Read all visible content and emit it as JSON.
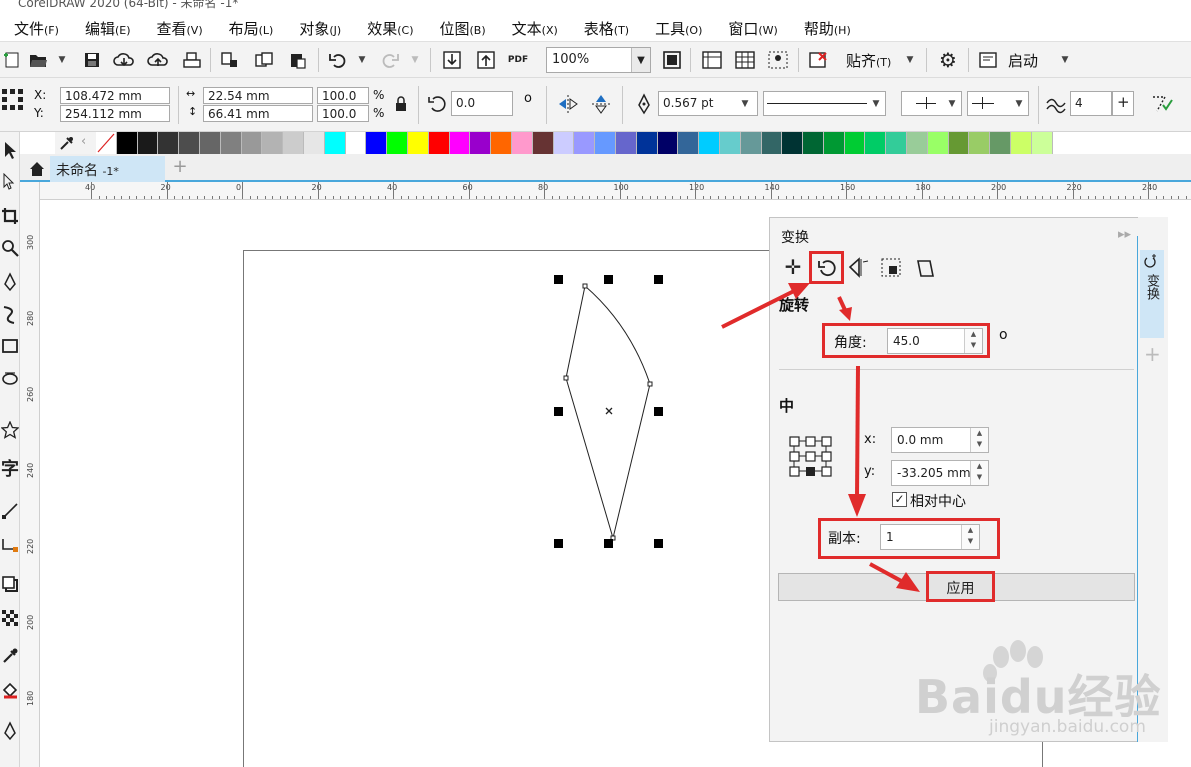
{
  "window": {
    "title": "CorelDRAW 2020 (64-Bit) - 未命名 -1*"
  },
  "menu": [
    {
      "label": "文件",
      "key": "(F)"
    },
    {
      "label": "编辑",
      "key": "(E)"
    },
    {
      "label": "查看",
      "key": "(V)"
    },
    {
      "label": "布局",
      "key": "(L)"
    },
    {
      "label": "对象",
      "key": "(J)"
    },
    {
      "label": "效果",
      "key": "(C)"
    },
    {
      "label": "位图",
      "key": "(B)"
    },
    {
      "label": "文本",
      "key": "(X)"
    },
    {
      "label": "表格",
      "key": "(T)"
    },
    {
      "label": "工具",
      "key": "(O)"
    },
    {
      "label": "窗口",
      "key": "(W)"
    },
    {
      "label": "帮助",
      "key": "(H)"
    }
  ],
  "toolbar": {
    "zoom": "100%",
    "pdf_label": "PDF",
    "snap_label": "贴齐",
    "snap_key": "(T)",
    "launch_label": "启动"
  },
  "propbar": {
    "x_label": "X:",
    "y_label": "Y:",
    "x_value": "108.472 mm",
    "y_value": "254.112 mm",
    "width_value": "22.54 mm",
    "height_value": "66.41 mm",
    "scale_x": "100.0",
    "scale_y": "100.0",
    "percent": "%",
    "rotation": "0.0",
    "degree": "o",
    "outline_width": "0.567 pt",
    "smoothing": "4"
  },
  "palette": [
    "#ffffff",
    "#000000",
    "#1a1a1a",
    "#333333",
    "#4d4d4d",
    "#666666",
    "#808080",
    "#999999",
    "#b3b3b3",
    "#cccccc",
    "#e6e6e6",
    "#00ffff",
    "#ffffff",
    "#0000ff",
    "#00ff00",
    "#ffff00",
    "#ff0000",
    "#ff00ff",
    "#9900cc",
    "#ff6600",
    "#ff99cc",
    "#663333",
    "#ccccff",
    "#9999ff",
    "#6699ff",
    "#6666cc",
    "#003399",
    "#000066",
    "#336699",
    "#00ccff",
    "#66cccc",
    "#669999",
    "#336666",
    "#003333",
    "#006633",
    "#009933",
    "#00cc33",
    "#00cc66",
    "#33cc99",
    "#99cc99",
    "#99ff66",
    "#669933",
    "#99cc66",
    "#669966",
    "#ccff66",
    "#ccff99"
  ],
  "document": {
    "tab_label": "未命名",
    "tab_suffix": "-1*"
  },
  "ruler": {
    "h_labels": [
      "40",
      "20",
      "0",
      "20",
      "40",
      "60",
      "80",
      "100",
      "120",
      "140",
      "160",
      "180",
      "200",
      "220",
      "240"
    ],
    "v_labels": [
      "300",
      "280",
      "260",
      "240",
      "220",
      "200",
      "180"
    ]
  },
  "docker": {
    "title": "变换",
    "section_rotate": "旋转",
    "angle_label": "角度:",
    "angle_value": "45.0",
    "degree": "o",
    "section_center": "中",
    "x_label": "x:",
    "x_value": "0.0 mm",
    "y_label": "y:",
    "y_value": "-33.205 mm",
    "relative_center_label": "相对中心",
    "relative_center_checked": true,
    "copies_label": "副本:",
    "copies_value": "1",
    "apply_label": "应用",
    "side_tab_label": "变换"
  },
  "watermark": {
    "brand": "Baidu经验",
    "url": "jingyan.baidu.com"
  },
  "colors": {
    "annotation_red": "#e02b2b",
    "accent_blue": "#49a7db"
  }
}
